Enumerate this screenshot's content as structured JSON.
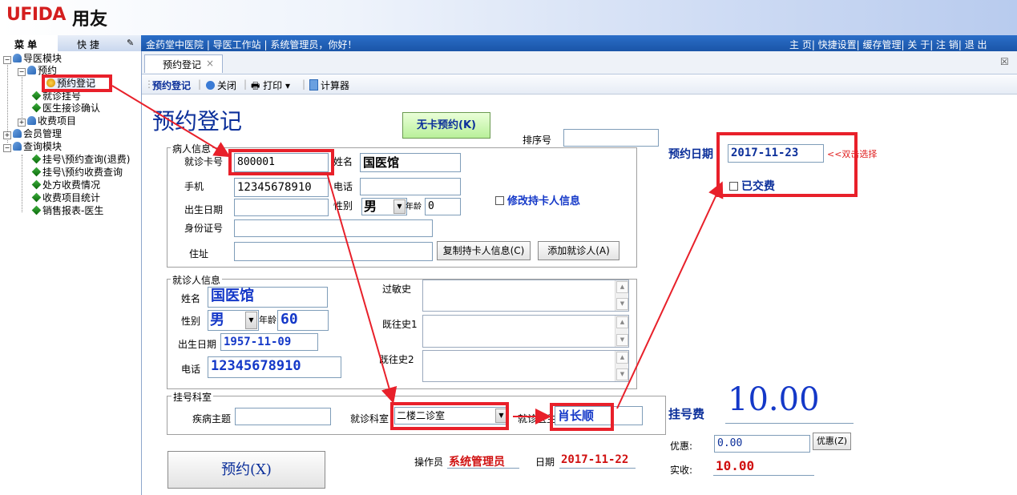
{
  "brand": {
    "logo": "UFIDA",
    "logo_cn": "用友"
  },
  "nav": {
    "menu_tab": "菜 单",
    "quick_tab": "快 捷",
    "status": "金药堂中医院  | 导医工作站 | 系统管理员，你好！",
    "links": "主 页| 快捷设置| 缓存管理| 关 于| 注 销| 退 出"
  },
  "tree": {
    "guide_module": "导医模块",
    "appointment": "预约",
    "appointment_register": "预约登记",
    "visit_register": "就诊挂号",
    "doctor_confirm": "医生接诊确认",
    "fee_items": "收费项目",
    "member_mgmt": "会员管理",
    "query_module": "查询模块",
    "q1": "挂号\\预约查询(退费)",
    "q2": "挂号\\预约收费查询",
    "q3": "处方收费情况",
    "q4": "收费项目统计",
    "q5": "销售报表-医生"
  },
  "tab": {
    "label": "预约登记",
    "close": "×",
    "restore": "☒"
  },
  "toolbar": {
    "register": "预约登记",
    "close": "关闭",
    "print": "打印",
    "calculator": "计算器"
  },
  "form": {
    "title": "预约登记",
    "no_card_btn": "无卡预约(K)",
    "sort_no_label": "排序号",
    "sort_no": "",
    "patient_group": "病人信息",
    "card_no_label": "就诊卡号",
    "card_no": "800001",
    "name_label": "姓名",
    "name": "国医馆",
    "mobile_label": "手机",
    "mobile": "12345678910",
    "phone_label": "电话",
    "phone": "",
    "birth_label": "出生日期",
    "birth": "",
    "gender_label": "性别",
    "gender": "男",
    "age_label": "年龄",
    "age": "0",
    "id_label": "身份证号",
    "id_no": "",
    "address_label": "住址",
    "address": "",
    "copy_btn": "复制持卡人信息(C)",
    "add_patient_btn": "添加就诊人(A)",
    "modify_holder": "修改持卡人信息",
    "visitor_group": "就诊人信息",
    "v_name_label": "姓名",
    "v_name": "国医馆",
    "v_gender_label": "性别",
    "v_gender": "男",
    "v_age_label": "年龄",
    "v_age": "60",
    "v_birth_label": "出生日期",
    "v_birth": "1957-11-09",
    "v_phone_label": "电话",
    "v_phone": "12345678910",
    "allergy_label": "过敏史",
    "history1_label": "既往史1",
    "history2_label": "既往史2",
    "dept_group": "挂号科室",
    "subject_label": "疾病主题",
    "subject": "",
    "dept_label": "就诊科室",
    "dept": "二楼二诊室",
    "doctor_label": "就诊医生",
    "doctor": "肖长顺",
    "appt_date_label": "预约日期",
    "appt_date": "2017-11-23",
    "dblclick_hint": "<<双击选择",
    "paid_label": "已交费",
    "fee_label": "挂号费",
    "fee": "10.00",
    "discount_label": "优惠:",
    "discount": "0.00",
    "discount_btn": "优惠(Z)",
    "actual_label": "实收:",
    "actual": "10.00",
    "submit_btn": "预约(X)",
    "operator_label": "操作员",
    "operator": "系统管理员",
    "date_label": "日期",
    "date": "2017-11-22"
  },
  "colors": {
    "annotation": "#e8202a",
    "accent_blue": "#1438c8",
    "value_red": "#d01010"
  }
}
